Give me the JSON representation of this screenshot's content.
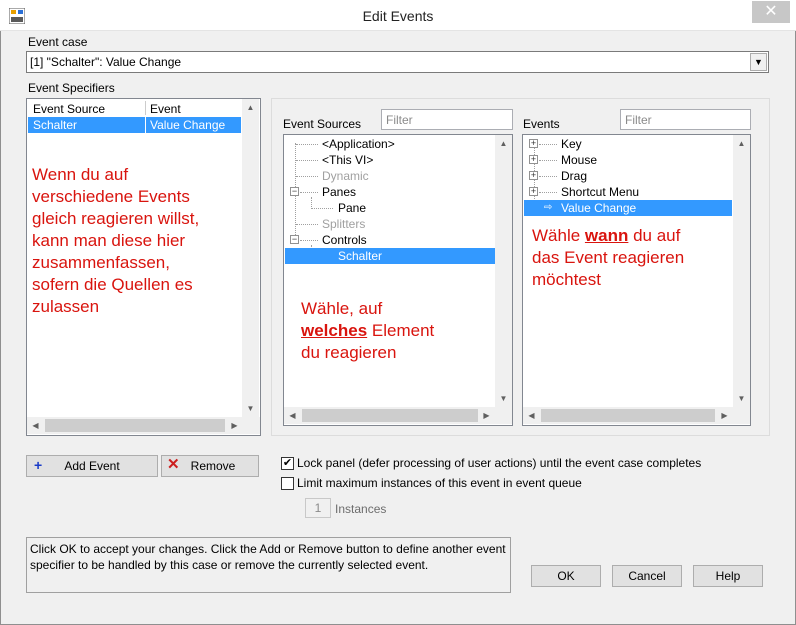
{
  "window": {
    "title": "Edit Events",
    "close_glyph": "✕"
  },
  "event_case": {
    "label": "Event case",
    "value": "[1] \"Schalter\": Value Change"
  },
  "event_specifiers": {
    "label": "Event Specifiers",
    "columns": [
      "Event Source",
      "Event"
    ],
    "rows": [
      {
        "source": "Schalter",
        "event": "Value Change"
      }
    ]
  },
  "event_sources": {
    "label": "Event Sources",
    "filter_placeholder": "Filter",
    "items": [
      {
        "label": "<Application>",
        "enabled": true
      },
      {
        "label": "<This VI>",
        "enabled": true
      },
      {
        "label": "Dynamic",
        "enabled": false
      },
      {
        "label": "Panes",
        "enabled": true
      },
      {
        "label": "Pane",
        "enabled": true
      },
      {
        "label": "Splitters",
        "enabled": false
      },
      {
        "label": "Controls",
        "enabled": true
      },
      {
        "label": "Schalter",
        "enabled": true,
        "selected": true
      }
    ]
  },
  "events": {
    "label": "Events",
    "filter_placeholder": "Filter",
    "items": [
      {
        "label": "Key"
      },
      {
        "label": "Mouse"
      },
      {
        "label": "Drag"
      },
      {
        "label": "Shortcut Menu"
      },
      {
        "label": "Value Change",
        "selected": true
      }
    ]
  },
  "annotations": {
    "specifiers": [
      "Wenn du auf",
      "verschiedene Events",
      "gleich reagieren willst,",
      "kann man diese hier",
      "zusammenfassen,",
      "sofern die Quellen es",
      "zulassen"
    ],
    "sources": {
      "line1": "Wähle, auf",
      "emph": "welches",
      "line2_rest": " Element",
      "line3": "du reagieren"
    },
    "events": {
      "pre": "Wähle ",
      "emph": "wann",
      "line1_rest": " du auf",
      "line2": "das Event reagieren",
      "line3": "möchtest"
    },
    "color": "#d9140e"
  },
  "buttons": {
    "add_event": "Add Event",
    "remove": "Remove",
    "ok": "OK",
    "cancel": "Cancel",
    "help": "Help"
  },
  "options": {
    "lock_panel": {
      "label": "Lock panel (defer processing of user actions) until the event case completes",
      "checked": true
    },
    "limit_instances": {
      "label": "Limit maximum instances of this event in event queue",
      "checked": false
    },
    "instances": {
      "value": "1",
      "label": "Instances"
    }
  },
  "info_text": "Click OK to accept your changes.  Click the Add or Remove button to define another event specifier to be handled by this case or remove the currently selected event.",
  "colors": {
    "selection": "#3399ff",
    "annotation": "#d9140e",
    "add_icon": "#1a3cc8",
    "remove_icon": "#cc1f1f"
  },
  "icons": [
    "app-icon",
    "close-icon",
    "dropdown-arrow-icon",
    "plus-icon",
    "x-icon",
    "arrow-icon",
    "checkmark-icon"
  ]
}
